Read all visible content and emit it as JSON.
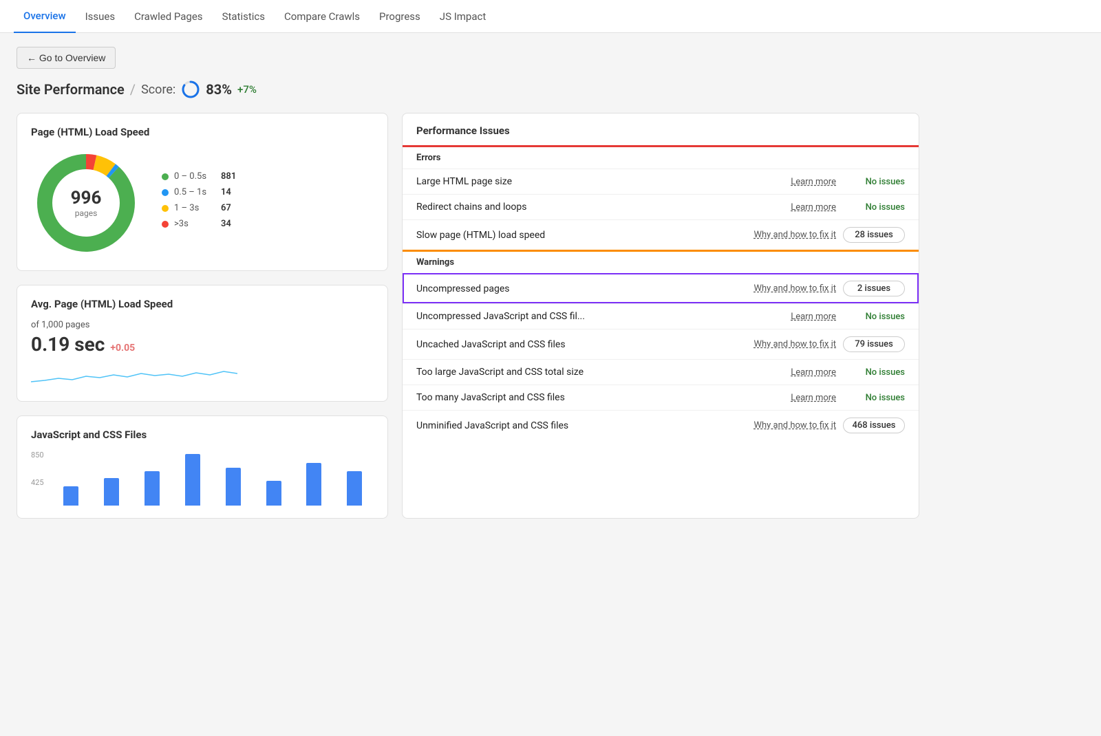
{
  "nav": {
    "items": [
      {
        "label": "Overview",
        "active": true
      },
      {
        "label": "Issues",
        "active": false
      },
      {
        "label": "Crawled Pages",
        "active": false
      },
      {
        "label": "Statistics",
        "active": false
      },
      {
        "label": "Compare Crawls",
        "active": false
      },
      {
        "label": "Progress",
        "active": false
      },
      {
        "label": "JS Impact",
        "active": false
      }
    ]
  },
  "back_button": "← Go to Overview",
  "page_title": {
    "main": "Site Performance",
    "separator": "/",
    "score_label": "Score:",
    "score_value": "83%",
    "score_change": "+7%"
  },
  "load_speed_card": {
    "title": "Page (HTML) Load Speed",
    "total_pages": "996",
    "pages_label": "pages",
    "legend": [
      {
        "color": "#4caf50",
        "range": "0 – 0.5s",
        "count": "881"
      },
      {
        "color": "#2196f3",
        "range": "0.5 – 1s",
        "count": "14"
      },
      {
        "color": "#ffc107",
        "range": "1 – 3s",
        "count": "67"
      },
      {
        "color": "#f44336",
        "range": ">3s",
        "count": "34"
      }
    ]
  },
  "avg_load_card": {
    "title": "Avg. Page (HTML) Load Speed",
    "subtitle": "of 1,000 pages",
    "value": "0.19 sec",
    "change": "+0.05"
  },
  "js_css_card": {
    "title": "JavaScript and CSS Files",
    "y_labels": [
      "850",
      "425"
    ],
    "bars": [
      30,
      45,
      55,
      100,
      60,
      40,
      70,
      55
    ]
  },
  "performance_issues": {
    "title": "Performance Issues",
    "sections": [
      {
        "label": "Errors",
        "type": "errors",
        "items": [
          {
            "name": "Large HTML page size",
            "link": "Learn more",
            "link_type": "learn",
            "status": "no_issues",
            "status_text": "No issues"
          },
          {
            "name": "Redirect chains and loops",
            "link": "Learn more",
            "link_type": "learn",
            "status": "no_issues",
            "status_text": "No issues"
          },
          {
            "name": "Slow page (HTML) load speed",
            "link": "Why and how to fix it",
            "link_type": "fix",
            "status": "issues",
            "status_text": "28 issues"
          }
        ]
      },
      {
        "label": "Warnings",
        "type": "warnings",
        "items": [
          {
            "name": "Uncompressed pages",
            "link": "Why and how to fix it",
            "link_type": "fix",
            "status": "issues",
            "status_text": "2 issues",
            "highlighted": true
          },
          {
            "name": "Uncompressed JavaScript and CSS fil...",
            "link": "Learn more",
            "link_type": "learn",
            "status": "no_issues",
            "status_text": "No issues"
          },
          {
            "name": "Uncached JavaScript and CSS files",
            "link": "Why and how to fix it",
            "link_type": "fix",
            "status": "issues",
            "status_text": "79 issues"
          },
          {
            "name": "Too large JavaScript and CSS total size",
            "link": "Learn more",
            "link_type": "learn",
            "status": "no_issues",
            "status_text": "No issues"
          },
          {
            "name": "Too many JavaScript and CSS files",
            "link": "Learn more",
            "link_type": "learn",
            "status": "no_issues",
            "status_text": "No issues"
          },
          {
            "name": "Unminified JavaScript and CSS files",
            "link": "Why and how to fix it",
            "link_type": "fix",
            "status": "issues",
            "status_text": "468 issues"
          }
        ]
      }
    ]
  }
}
